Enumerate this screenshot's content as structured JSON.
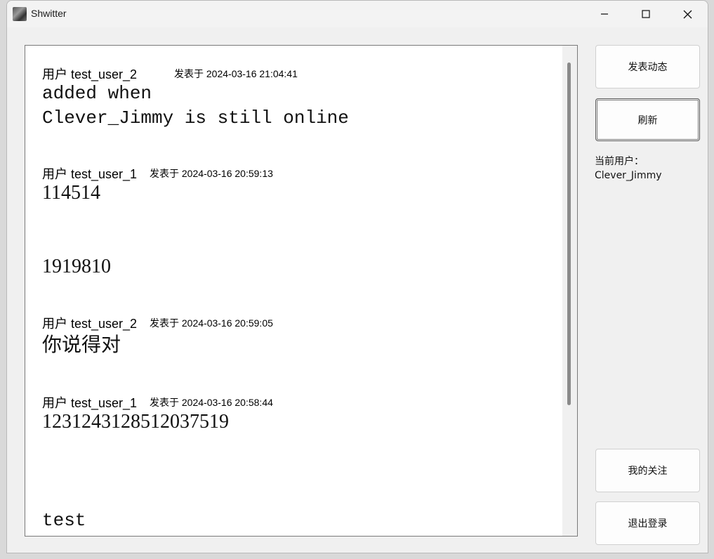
{
  "window": {
    "title": "Shwitter"
  },
  "icons": {
    "app": "app-icon",
    "minimize": "minimize-icon",
    "maximize": "maximize-icon",
    "close": "close-icon"
  },
  "posts": [
    {
      "user": "用户 test_user_2",
      "time": "发表于 2024-03-16 21:04:41",
      "lines": [
        "added when",
        "Clever_Jimmy is still online"
      ]
    },
    {
      "user": "用户 test_user_1",
      "time": "发表于 2024-03-16 20:59:13",
      "lines": [
        "114514",
        "1919810"
      ]
    },
    {
      "user": "用户 test_user_2",
      "time": "发表于 2024-03-16 20:59:05",
      "lines": [
        "你说得对"
      ]
    },
    {
      "user": "用户 test_user_1",
      "time": "发表于 2024-03-16 20:58:44",
      "lines": [
        "1231243128512037519",
        "test"
      ]
    }
  ],
  "sidebar": {
    "post_label": "发表动态",
    "refresh_label": "刷新",
    "current_user_label": "当前用户：",
    "current_user_name": "Clever_Jimmy",
    "following_label": "我的关注",
    "logout_label": "退出登录"
  }
}
